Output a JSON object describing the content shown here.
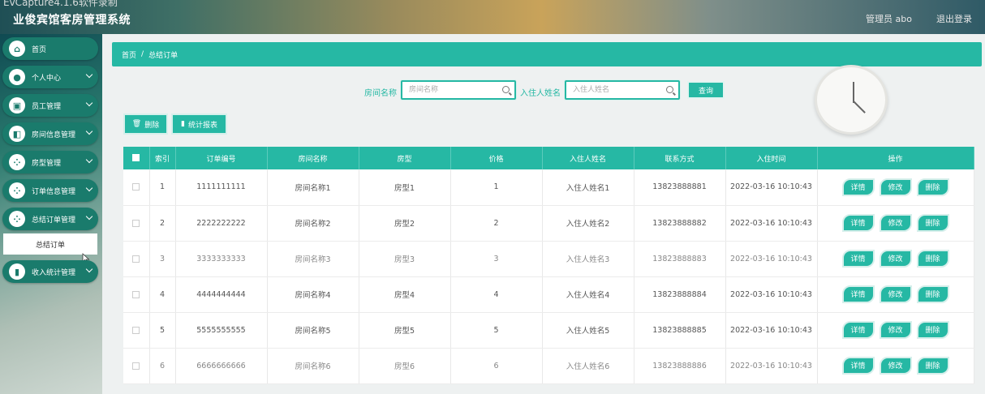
{
  "header": {
    "capture_text": "EvCapture4.1.6软件录制",
    "title": "业俊宾馆客房管理系统",
    "user": "管理员 abo",
    "logout": "退出登录"
  },
  "sidebar": {
    "items": [
      {
        "label": "首页",
        "icon": "home-icon",
        "glyph": "⌂",
        "has_arrow": false
      },
      {
        "label": "个人中心",
        "icon": "user-icon",
        "glyph": "●",
        "has_arrow": true
      },
      {
        "label": "员工管理",
        "icon": "briefcase-icon",
        "glyph": "▣",
        "has_arrow": true
      },
      {
        "label": "房间信息管理",
        "icon": "room-icon",
        "glyph": "◧",
        "has_arrow": true
      },
      {
        "label": "房型管理",
        "icon": "grid-icon",
        "glyph": "⁘",
        "has_arrow": true
      },
      {
        "label": "订单信息管理",
        "icon": "grid-icon",
        "glyph": "⁘",
        "has_arrow": true
      },
      {
        "label": "总结订单管理",
        "icon": "grid-icon",
        "glyph": "⁘",
        "has_arrow": true
      },
      {
        "label": "收入统计管理",
        "icon": "bag-icon",
        "glyph": "▮",
        "has_arrow": true
      }
    ],
    "submenu_active": "总结订单"
  },
  "breadcrumb": {
    "home": "首页",
    "separator": "/",
    "current": "总结订单"
  },
  "search": {
    "room_label": "房间名称",
    "room_placeholder": "房间名称",
    "guest_label": "入住人姓名",
    "guest_placeholder": "入住人姓名",
    "query_button": "查询"
  },
  "actions": {
    "delete": "删除",
    "stats": "统计报表"
  },
  "table": {
    "headers": [
      "",
      "索引",
      "订单编号",
      "房间名称",
      "房型",
      "价格",
      "入住人姓名",
      "联系方式",
      "入住时间",
      "操作"
    ],
    "op_labels": {
      "detail": "详情",
      "edit": "修改",
      "delete": "删除"
    },
    "rows": [
      {
        "index": "1",
        "order_no": "1111111111",
        "room": "房间名称1",
        "type": "房型1",
        "price": "1",
        "guest": "入住人姓名1",
        "phone": "13823888881",
        "time": "2022-03-16 10:10:43"
      },
      {
        "index": "2",
        "order_no": "2222222222",
        "room": "房间名称2",
        "type": "房型2",
        "price": "2",
        "guest": "入住人姓名2",
        "phone": "13823888882",
        "time": "2022-03-16 10:10:43"
      },
      {
        "index": "3",
        "order_no": "3333333333",
        "room": "房间名称3",
        "type": "房型3",
        "price": "3",
        "guest": "入住人姓名3",
        "phone": "13823888883",
        "time": "2022-03-16 10:10:43"
      },
      {
        "index": "4",
        "order_no": "4444444444",
        "room": "房间名称4",
        "type": "房型4",
        "price": "4",
        "guest": "入住人姓名4",
        "phone": "13823888884",
        "time": "2022-03-16 10:10:43"
      },
      {
        "index": "5",
        "order_no": "5555555555",
        "room": "房间名称5",
        "type": "房型5",
        "price": "5",
        "guest": "入住人姓名5",
        "phone": "13823888885",
        "time": "2022-03-16 10:10:43"
      },
      {
        "index": "6",
        "order_no": "6666666666",
        "room": "房间名称6",
        "type": "房型6",
        "price": "6",
        "guest": "入住人姓名6",
        "phone": "13823888886",
        "time": "2022-03-16 10:10:43"
      }
    ]
  },
  "colors": {
    "accent": "#26b8a4",
    "sidebar_item": "#1a7b6c"
  }
}
